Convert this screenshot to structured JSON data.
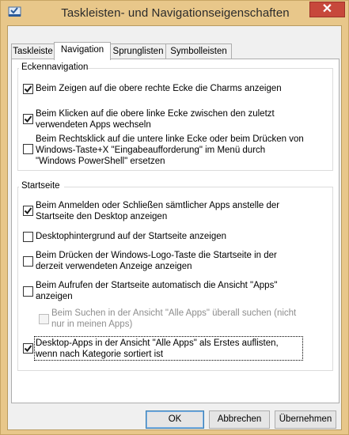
{
  "window": {
    "title": "Taskleisten- und Navigationseigenschaften",
    "close_glyph": "✕",
    "icon": "taskbar-properties-icon"
  },
  "tabs": [
    {
      "label": "Taskleiste",
      "active": false
    },
    {
      "label": "Navigation",
      "active": true
    },
    {
      "label": "Sprunglisten",
      "active": false
    },
    {
      "label": "Symbolleisten",
      "active": false
    }
  ],
  "corner_nav": {
    "title": "Eckennavigation",
    "options": [
      {
        "line1": "Beim Zeigen auf die obere rechte Ecke die Charms anzeigen",
        "line2": "",
        "checked": true
      },
      {
        "line1": "Beim Klicken auf die obere linke Ecke zwischen den zuletzt",
        "line2": "verwendeten Apps wechseln",
        "checked": true
      },
      {
        "line1": "Beim Rechtsklick auf die untere linke Ecke oder beim Drücken von",
        "line2": "Windows-Taste+X \"Eingabeaufforderung\" im Menü durch",
        "line3": "\"Windows PowerShell\" ersetzen",
        "checked": false
      }
    ]
  },
  "start": {
    "title": "Startseite",
    "options": [
      {
        "line1": "Beim Anmelden oder Schließen sämtlicher Apps anstelle der",
        "line2": "Startseite den Desktop anzeigen",
        "checked": true,
        "enabled": true
      },
      {
        "line1": "Desktophintergrund auf der Startseite anzeigen",
        "line2": "",
        "checked": false,
        "enabled": true
      },
      {
        "line1": "Beim Drücken der Windows-Logo-Taste die Startseite in der",
        "line2": "derzeit verwendeten Anzeige anzeigen",
        "checked": false,
        "enabled": true
      },
      {
        "line1": "Beim Aufrufen der Startseite automatisch die Ansicht \"Apps\"",
        "line2": "anzeigen",
        "checked": false,
        "enabled": true
      },
      {
        "line1": "Beim Suchen in der Ansicht \"Alle Apps\" überall suchen (nicht",
        "line2": "nur in meinen Apps)",
        "checked": false,
        "enabled": false
      },
      {
        "line1": "Desktop-Apps in der Ansicht \"Alle Apps\" als Erstes auflisten,",
        "line2": "wenn nach Kategorie sortiert ist",
        "checked": true,
        "enabled": true
      }
    ]
  },
  "buttons": {
    "ok": "OK",
    "cancel": "Abbrechen",
    "apply": "Übernehmen"
  },
  "colors": {
    "title_bar": "#e8c78a",
    "close_button": "#c7483b",
    "check_mark": "#1a1a1a"
  }
}
